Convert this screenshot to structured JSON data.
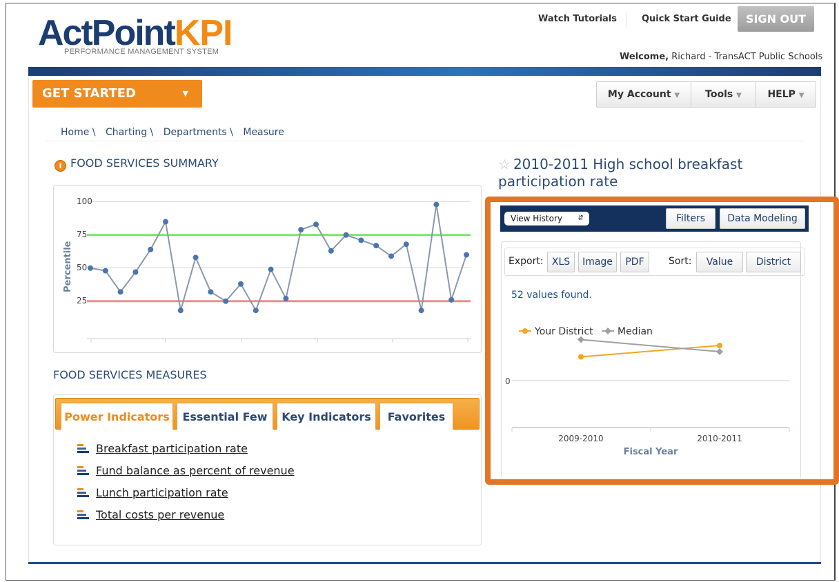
{
  "header": {
    "logo_part1": "ActPoint",
    "logo_part2": "KPI",
    "logo_tagline": "PERFORMANCE MANAGEMENT SYSTEM",
    "watch_tutorials": "Watch Tutorials",
    "quick_start": "Quick Start Guide",
    "sign_out": "SIGN OUT",
    "welcome_label": "Welcome,",
    "welcome_user": "Richard - TransACT Public Schools"
  },
  "nav": {
    "get_started": "GET STARTED",
    "my_account": "My Account",
    "tools": "Tools",
    "help": "HELP"
  },
  "breadcrumb": [
    "Home \\",
    "Charting \\",
    "Departments \\",
    "Measure"
  ],
  "summary": {
    "title": "FOOD SERVICES SUMMARY",
    "chart_data": {
      "type": "line",
      "ylabel": "Percentile",
      "yticks": [
        "100",
        "75",
        "50",
        "25"
      ],
      "ylim": [
        10,
        110
      ],
      "values": [
        57,
        55,
        39,
        54,
        71,
        92,
        25,
        65,
        39,
        32,
        45,
        25,
        56,
        34,
        86,
        90,
        70,
        82,
        78,
        74,
        66,
        75,
        25,
        105,
        33,
        67
      ],
      "upper_line": 82,
      "lower_line": 32,
      "colors": {
        "line": "#8a98ab",
        "point": "#4c74b0",
        "upper": "#7ce36e",
        "lower": "#e89090"
      }
    }
  },
  "measures": {
    "title": "FOOD SERVICES MEASURES",
    "tabs": [
      "Power Indicators",
      "Essential Few",
      "Key Indicators",
      "Favorites"
    ],
    "items": [
      "Breakfast participation rate",
      "Fund balance as percent of revenue",
      "Lunch participation rate",
      "Total costs per revenue"
    ]
  },
  "kpi": {
    "title": "2010-2011 High school breakfast participation rate",
    "view_history": "View History",
    "filters": "Filters",
    "data_modeling": "Data Modeling",
    "export_label": "Export:",
    "xls": "XLS",
    "image": "Image",
    "pdf": "PDF",
    "sort_label": "Sort:",
    "value": "Value",
    "district": "District",
    "found": "52 values found.",
    "chart_data": {
      "type": "line",
      "xlabel": "Fiscal Year",
      "categories": [
        "2009-2010",
        "2010-2011"
      ],
      "ytick": "0",
      "series": [
        {
          "name": "Your District",
          "color": "#f5a623",
          "values": [
            0.25,
            0.58
          ]
        },
        {
          "name": "Median",
          "color": "#a0a0a0",
          "values": [
            0.75,
            0.4
          ]
        }
      ]
    }
  }
}
